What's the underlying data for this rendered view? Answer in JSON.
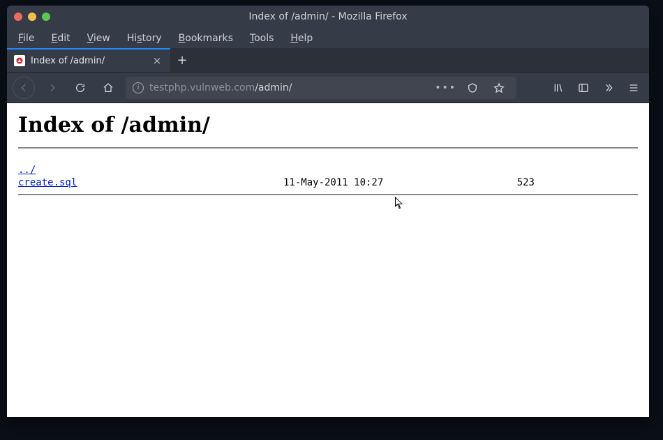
{
  "window": {
    "title": "Index of /admin/ - Mozilla Firefox"
  },
  "menubar": {
    "file": "File",
    "edit": "Edit",
    "view": "View",
    "history": "History",
    "bookmarks": "Bookmarks",
    "tools": "Tools",
    "help": "Help"
  },
  "tab": {
    "title": "Index of /admin/"
  },
  "url": {
    "host": "testphp.vulnweb.com",
    "path": "/admin/"
  },
  "page": {
    "heading": "Index of /admin/",
    "parent_link": "../",
    "files": [
      {
        "name": "create.sql",
        "date": "11-May-2011 10:27",
        "size": "523"
      }
    ]
  }
}
